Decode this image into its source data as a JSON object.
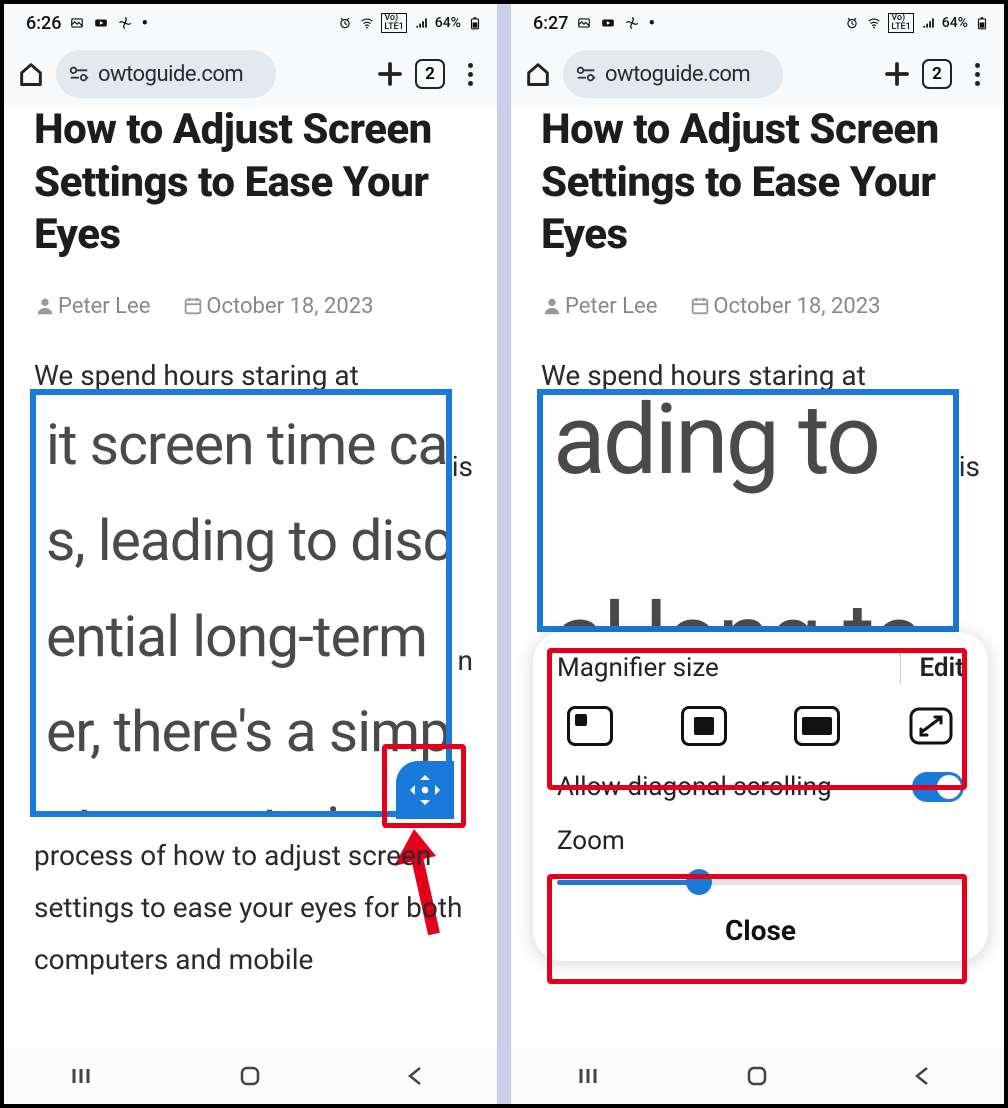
{
  "left": {
    "status": {
      "time": "6:26",
      "battery": "64%"
    },
    "browser": {
      "url": "owtoguide.com",
      "tabs": "2"
    },
    "article": {
      "title": "How to Adjust Screen Settings to Ease Your Eyes",
      "author": "Peter Lee",
      "date": "October 18, 2023",
      "intro": "We spend hours staring at",
      "trail_is": "is",
      "trail_n": "n",
      "mag_lines": [
        "it screen time ca",
        "s, leading to disc",
        "ential long-term",
        "er, there's a simpl",
        "ate eye strain –"
      ],
      "after": "process of how to adjust screen settings to ease your eyes for both computers and mobile"
    }
  },
  "right": {
    "status": {
      "time": "6:27",
      "battery": "64%"
    },
    "browser": {
      "url": "owtoguide.com",
      "tabs": "2"
    },
    "article": {
      "title": "How to Adjust Screen Settings to Ease Your Eyes",
      "author": "Peter Lee",
      "date": "October 18, 2023",
      "intro": "We spend hours staring at",
      "trail_is": "is",
      "mag_lines": [
        "ading to",
        "al long-te"
      ]
    },
    "panel": {
      "mag_size": "Magnifier size",
      "edit": "Edit",
      "diag": "Allow diagonal scrolling",
      "zoom": "Zoom",
      "zoom_pct": 35,
      "close": "Close"
    }
  }
}
